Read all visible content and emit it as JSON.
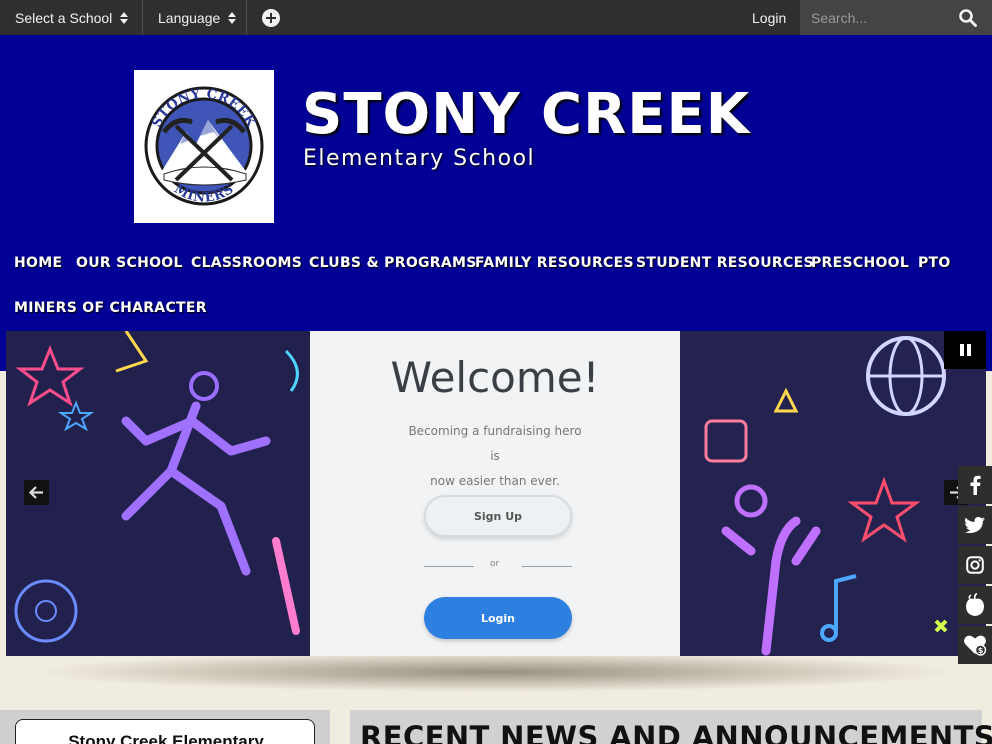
{
  "topbar": {
    "select_school": "Select a School",
    "language": "Language",
    "login": "Login",
    "search_placeholder": "Search..."
  },
  "header": {
    "logo_text_top": "STONY CREEK",
    "logo_text_bottom": "MINERS",
    "title": "STONY CREEK",
    "subtitle": "Elementary School"
  },
  "nav": {
    "items": [
      "HOME",
      "OUR SCHOOL",
      "CLASSROOMS",
      "CLUBS & PROGRAMS",
      "FAMILY RESOURCES",
      "STUDENT RESOURCES",
      "PRESCHOOL",
      "PTO",
      "MINERS OF CHARACTER"
    ]
  },
  "slide": {
    "heading": "Welcome!",
    "line1": "Becoming a fundraising hero is",
    "line2": "now easier than ever.",
    "signup": "Sign Up",
    "or": "or",
    "login": "Login"
  },
  "social": {
    "icons": [
      "facebook-icon",
      "twitter-icon",
      "instagram-icon",
      "peachjar-icon",
      "donate-icon"
    ]
  },
  "content": {
    "school_card_title": "Stony Creek Elementary",
    "news_heading": "RECENT NEWS AND ANNOUNCEMENTS"
  },
  "colors": {
    "header_blue": "#010195",
    "topbar": "#2f2f2f",
    "page_bg": "#f1ece0",
    "login_blue": "#2d7fe0"
  }
}
